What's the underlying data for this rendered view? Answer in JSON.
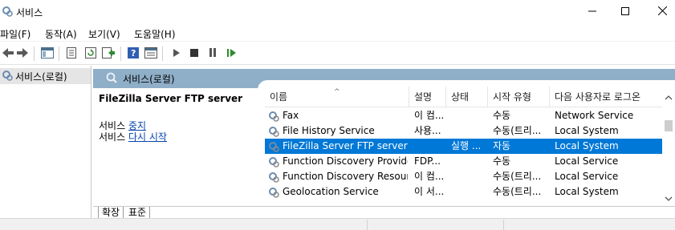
{
  "window": {
    "title": "서비스",
    "icon": "gear-icon",
    "controls": [
      "minimize-icon",
      "maximize-icon",
      "close-icon"
    ]
  },
  "menu": [
    "파일(F)",
    "동작(A)",
    "보기(V)",
    "도움말(H)"
  ],
  "toolbar": {
    "icons": [
      "back-icon",
      "forward-icon",
      "show-hide-tree-icon",
      "properties-icon",
      "refresh-icon",
      "export-list-icon",
      "help-icon",
      "view-icon",
      "start-service-icon",
      "stop-service-icon",
      "pause-service-icon",
      "resume-service-icon"
    ]
  },
  "tree": {
    "item": "서비스(로컬)"
  },
  "header": {
    "title": "서비스(로컬)"
  },
  "detail": {
    "service_name": "FileZilla Server FTP server",
    "line1_prefix": "서비스 ",
    "line1_link": "중지",
    "line2_prefix": "서비스 ",
    "line2_link": "다시 시작"
  },
  "list": {
    "columns": [
      "이름",
      "설명",
      "상태",
      "시작 유형",
      "다음 사용자로 로그온"
    ],
    "rows": [
      {
        "name": "Fax",
        "desc": "이 컴...",
        "status": "",
        "startup": "수동",
        "logon": "Network Service",
        "selected": false
      },
      {
        "name": "File History Service",
        "desc": "사용...",
        "status": "",
        "startup": "수동(트리...",
        "logon": "Local System",
        "selected": false
      },
      {
        "name": "FileZilla Server FTP server",
        "desc": "",
        "status": "실행 ...",
        "startup": "자동",
        "logon": "Local System",
        "selected": true
      },
      {
        "name": "Function Discovery Provide...",
        "desc": "FDP...",
        "status": "",
        "startup": "수동",
        "logon": "Local Service",
        "selected": false
      },
      {
        "name": "Function Discovery Resour...",
        "desc": "이 컴...",
        "status": "",
        "startup": "수동(트리...",
        "logon": "Local Service",
        "selected": false
      },
      {
        "name": "Geolocation Service",
        "desc": "이 서...",
        "status": "",
        "startup": "수동(트리...",
        "logon": "Local System",
        "selected": false
      }
    ]
  },
  "tabs": [
    "확장",
    "표준"
  ],
  "colors": {
    "header_band": "#8faec8",
    "selection": "#0078d7",
    "link": "#0645ad"
  }
}
